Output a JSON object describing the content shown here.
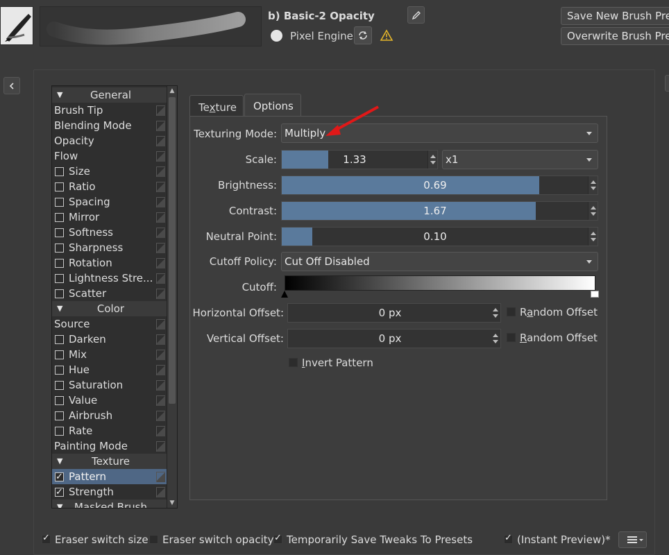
{
  "header": {
    "preset_name": "b) Basic-2 Opacity",
    "engine_label": "Pixel Engine",
    "save_label": "Save New Brush Preset",
    "overwrite_label": "Overwrite Brush Preset"
  },
  "options_list": [
    {
      "label": "General",
      "kind": "header"
    },
    {
      "label": "Brush Tip",
      "kind": "plain"
    },
    {
      "label": "Blending Mode",
      "kind": "plain"
    },
    {
      "label": "Opacity",
      "kind": "plain"
    },
    {
      "label": "Flow",
      "kind": "plain"
    },
    {
      "label": "Size",
      "kind": "check",
      "checked": false
    },
    {
      "label": "Ratio",
      "kind": "check",
      "checked": false
    },
    {
      "label": "Spacing",
      "kind": "check",
      "checked": false
    },
    {
      "label": "Mirror",
      "kind": "check",
      "checked": false
    },
    {
      "label": "Softness",
      "kind": "check",
      "checked": false
    },
    {
      "label": "Sharpness",
      "kind": "check",
      "checked": false
    },
    {
      "label": "Rotation",
      "kind": "check",
      "checked": false
    },
    {
      "label": "Lightness Stre...",
      "kind": "check",
      "checked": false
    },
    {
      "label": "Scatter",
      "kind": "check",
      "checked": false
    },
    {
      "label": "Color",
      "kind": "header"
    },
    {
      "label": "Source",
      "kind": "plain"
    },
    {
      "label": "Darken",
      "kind": "check",
      "checked": false
    },
    {
      "label": "Mix",
      "kind": "check",
      "checked": false
    },
    {
      "label": "Hue",
      "kind": "check",
      "checked": false
    },
    {
      "label": "Saturation",
      "kind": "check",
      "checked": false
    },
    {
      "label": "Value",
      "kind": "check",
      "checked": false
    },
    {
      "label": "Airbrush",
      "kind": "check",
      "checked": false
    },
    {
      "label": "Rate",
      "kind": "check",
      "checked": false
    },
    {
      "label": "Painting Mode",
      "kind": "plain"
    },
    {
      "label": "Texture",
      "kind": "header"
    },
    {
      "label": "Pattern",
      "kind": "check",
      "checked": true,
      "selected": true
    },
    {
      "label": "Strength",
      "kind": "check",
      "checked": true
    },
    {
      "label": "Masked Brush",
      "kind": "header"
    }
  ],
  "tabs": {
    "texture": "Texture",
    "options": "Options"
  },
  "form": {
    "texturing_mode_label": "Texturing Mode:",
    "texturing_mode_value": "Multiply",
    "scale_label": "Scale:",
    "scale_value": "1.33",
    "scale_fraction": 0.32,
    "scale_multiplier": "x1",
    "brightness_label": "Brightness:",
    "brightness_value": "0.69",
    "brightness_fraction": 0.84,
    "contrast_label": "Contrast:",
    "contrast_value": "1.67",
    "contrast_fraction": 0.83,
    "neutral_label": "Neutral Point:",
    "neutral_value": "0.10",
    "neutral_fraction": 0.1,
    "cutoff_policy_label": "Cutoff Policy:",
    "cutoff_policy_value": "Cut Off Disabled",
    "cutoff_label": "Cutoff:",
    "h_offset_label": "Horizontal Offset:",
    "h_offset_value": "0 px",
    "v_offset_label": "Vertical Offset:",
    "v_offset_value": "0 px",
    "random_offset_label": "Random Offset",
    "invert_pattern_label": "Invert Pattern"
  },
  "footer": {
    "eraser_size": "Eraser switch size",
    "eraser_opacity": "Eraser switch opacity",
    "temp_save": "Temporarily Save Tweaks To Presets",
    "instant_preview": "(Instant Preview)*"
  },
  "colors": {
    "accent": "#5a7a9c",
    "selection": "#4f6785",
    "annotation_arrow": "#e01818"
  }
}
